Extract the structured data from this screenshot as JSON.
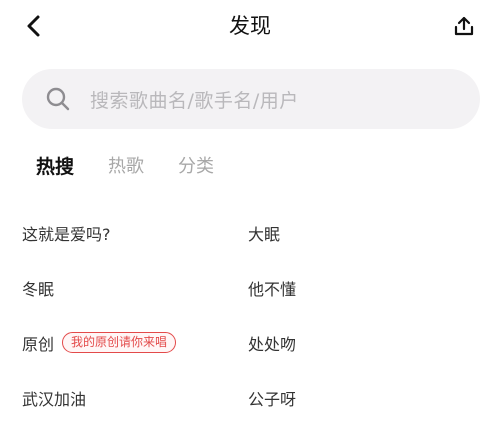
{
  "header": {
    "title": "发现",
    "back_icon": "chevron-left-icon",
    "share_icon": "upload-icon"
  },
  "search": {
    "placeholder": "搜索歌曲名/歌手名/用户",
    "icon": "search-icon"
  },
  "tabs": [
    {
      "label": "热搜",
      "active": true
    },
    {
      "label": "热歌",
      "active": false
    },
    {
      "label": "分类",
      "active": false
    }
  ],
  "hot_list": [
    {
      "left": "这就是爱吗?",
      "right": "大眠"
    },
    {
      "left": "冬眠",
      "right": "他不懂"
    },
    {
      "left": "原创",
      "left_tag": "我的原创请你来唱",
      "right": "处处吻"
    },
    {
      "left": "武汉加油",
      "right": "公子呀"
    }
  ],
  "colors": {
    "accent": "#ffd81a",
    "tag": "#e34a4a",
    "search_bg": "#f3f2f4"
  }
}
